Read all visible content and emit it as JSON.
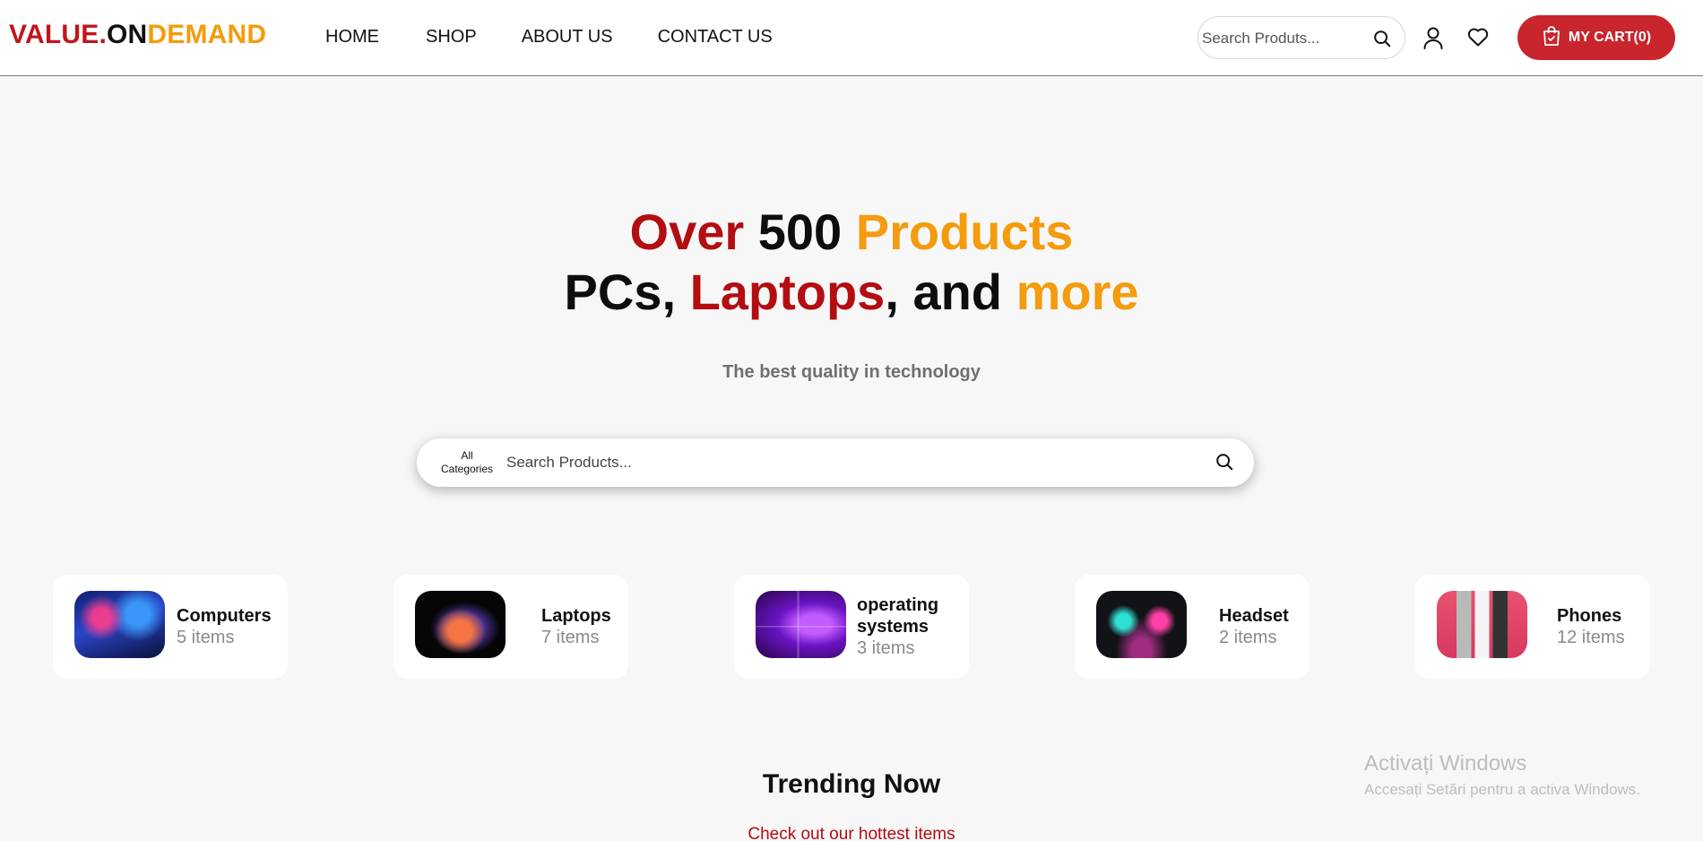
{
  "header": {
    "logo": {
      "part1": "VALUE.",
      "part2": "ON",
      "part3": "DEMAND",
      "colors": {
        "part1": "#c0161b",
        "part2": "#111111",
        "part3": "#f49b0e"
      }
    },
    "nav": [
      {
        "label": "HOME"
      },
      {
        "label": "SHOP"
      },
      {
        "label": "ABOUT US"
      },
      {
        "label": "CONTACT US"
      }
    ],
    "search_placeholder": "Search Produts...",
    "search_icon": "search-icon",
    "user_icon": "user-icon",
    "wishlist_icon": "heart-icon",
    "cart": {
      "label": "MY CART(0)",
      "icon": "shopping-bag-icon",
      "color": "#c8252c"
    }
  },
  "hero": {
    "line1": [
      {
        "text": "Over ",
        "color": "red"
      },
      {
        "text": "500 ",
        "color": "black"
      },
      {
        "text": "Products",
        "color": "orange"
      }
    ],
    "line2": [
      {
        "text": "PCs, ",
        "color": "black"
      },
      {
        "text": "Laptops",
        "color": "red"
      },
      {
        "text": ", and ",
        "color": "black"
      },
      {
        "text": "more",
        "color": "orange"
      }
    ],
    "subtitle": "The best quality in technology",
    "search": {
      "category_line1": "All",
      "category_line2": "Categories",
      "placeholder": "Search Products...",
      "icon": "search-icon"
    }
  },
  "categories": [
    {
      "name": "Computers",
      "count": "5 items",
      "image": "computers-image"
    },
    {
      "name": "Laptops",
      "count": "7 items",
      "image": "laptops-image"
    },
    {
      "name": "operating systems",
      "count": "3 items",
      "image": "operating-systems-image"
    },
    {
      "name": "Headset",
      "count": "2 items",
      "image": "headset-image"
    },
    {
      "name": "Phones",
      "count": "12 items",
      "image": "phones-image"
    }
  ],
  "trending": {
    "title": "Trending Now",
    "subtitle": "Check out our hottest items"
  },
  "watermark": {
    "title": "Activați Windows",
    "subtitle": "Accesați Setări pentru a activa Windows."
  }
}
